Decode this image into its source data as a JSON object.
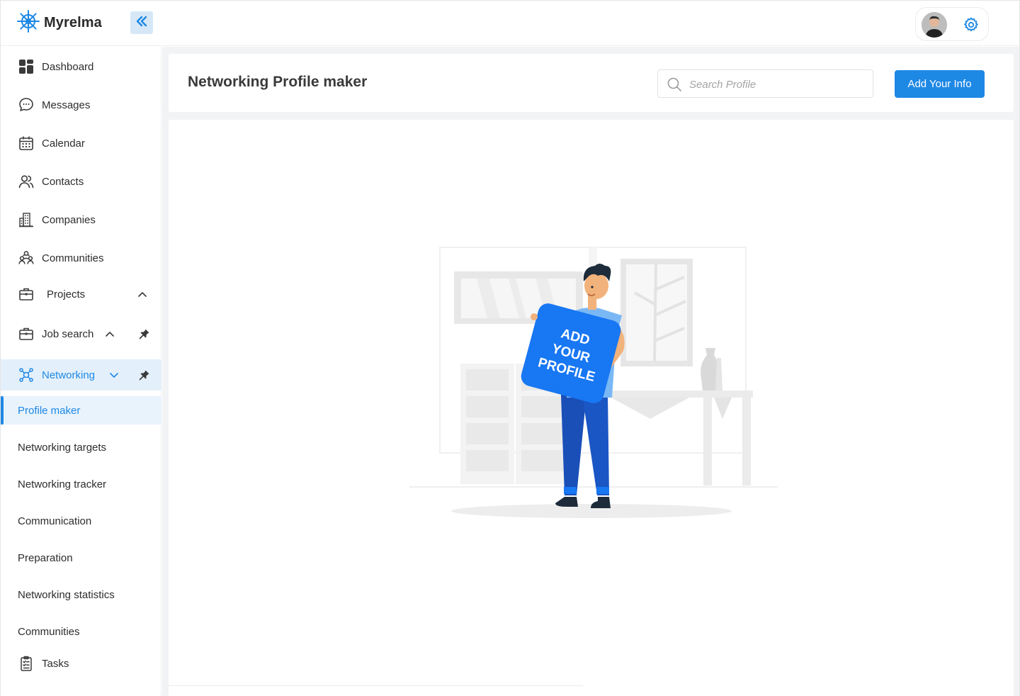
{
  "app": {
    "name": "Myrelma",
    "logo_icon": "ships-wheel-icon",
    "accent_color": "#1e88e5"
  },
  "topbar": {
    "collapse_icon": "double-chevron-left-icon",
    "avatar_icon": "user-avatar",
    "settings_icon": "gear-icon"
  },
  "sidebar": {
    "items": [
      {
        "label": "Dashboard",
        "icon": "dashboard-grid-icon"
      },
      {
        "label": "Messages",
        "icon": "chat-bubble-icon"
      },
      {
        "label": "Calendar",
        "icon": "calendar-icon"
      },
      {
        "label": "Contacts",
        "icon": "users-icon"
      },
      {
        "label": "Companies",
        "icon": "building-icon"
      },
      {
        "label": "Communities",
        "icon": "community-icon"
      },
      {
        "label": "Projects",
        "icon": "briefcase-icon",
        "expanded": true
      },
      {
        "label": "Job search",
        "icon": "briefcase-icon",
        "expanded": true,
        "pinned": true
      },
      {
        "label": "Networking",
        "icon": "network-icon",
        "expanded": true,
        "pinned": true,
        "active": true
      }
    ],
    "networking_subitems": [
      {
        "label": "Profile maker",
        "active": true
      },
      {
        "label": "Networking targets"
      },
      {
        "label": "Networking tracker"
      },
      {
        "label": "Communication"
      },
      {
        "label": "Preparation"
      },
      {
        "label": "Networking statistics"
      },
      {
        "label": "Communities"
      }
    ],
    "tasks": {
      "label": "Tasks",
      "icon": "clipboard-checklist-icon"
    }
  },
  "main": {
    "title": "Networking Profile maker",
    "search_placeholder": "Search Profile",
    "add_button_label": "Add Your Info",
    "illustration": {
      "sign_lines": [
        "ADD",
        "YOUR",
        "PROFILE"
      ],
      "sign_color": "#1877f2"
    }
  }
}
